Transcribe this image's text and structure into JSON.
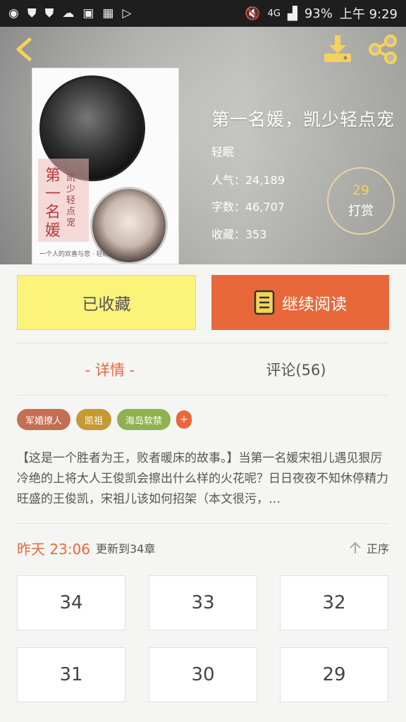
{
  "status_bar": {
    "left_icons": [
      "weibo-icon",
      "shield-icon",
      "shield-icon",
      "weather-icon",
      "bag-icon",
      "app-icon",
      "play-store-icon"
    ],
    "network": "4G",
    "battery": "93%",
    "time": "上午 9:29"
  },
  "header": {
    "title": "第一名媛，凯少轻点宠",
    "author": "轻眠",
    "popularity": "人气：24,189",
    "word_count": "字数：46,707",
    "favorites": "收藏：353",
    "tip_count": "29",
    "tip_label": "打赏"
  },
  "cover": {
    "title_chars": "第一名媛",
    "subtitle": "凯少轻点宠",
    "footer": "一个人的欢喜与悲 · 轻眠"
  },
  "actions": {
    "collected_label": "已收藏",
    "continue_label": "继续阅读"
  },
  "tabs": {
    "details": "- 详情 -",
    "comments": "评论(56)"
  },
  "tags": [
    {
      "label": "军婚撩人",
      "color": "#c46e52"
    },
    {
      "label": "凯祖",
      "color": "#c59a34"
    },
    {
      "label": "海岛软禁",
      "color": "#8fb24e"
    }
  ],
  "tag_add": "+",
  "description": "【这是一个胜者为王，败者暖床的故事。】当第一名媛宋祖儿遇见狠厉冷绝的上将大人王俊凯会擦出什么样的火花呢？日日夜夜不知休停精力旺盛的王俊凯，宋祖儿该如何招架（本文很污，…",
  "update": {
    "time": "昨天 23:06",
    "text": "更新到34章",
    "sort_label": "正序"
  },
  "chapters": [
    "34",
    "33",
    "32",
    "31",
    "30",
    "29"
  ],
  "colors": {
    "accent": "#e9683a",
    "collected_bg": "#fbf37a",
    "tip_number": "#f4d35a"
  }
}
